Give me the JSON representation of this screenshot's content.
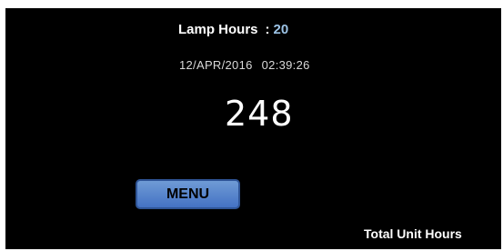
{
  "lamp": {
    "label": "Lamp Hours",
    "separator": ":",
    "value": "20"
  },
  "datetime": {
    "date": "12/APR/2016",
    "time": "02:39:26"
  },
  "counter": {
    "value": "248"
  },
  "menu": {
    "label": "MENU"
  },
  "footer": {
    "label": "Total Unit Hours"
  },
  "colors": {
    "background": "#000000",
    "accent_value": "#9cc3e6",
    "button_fill": "#4472c4",
    "button_border": "#2f5597"
  }
}
